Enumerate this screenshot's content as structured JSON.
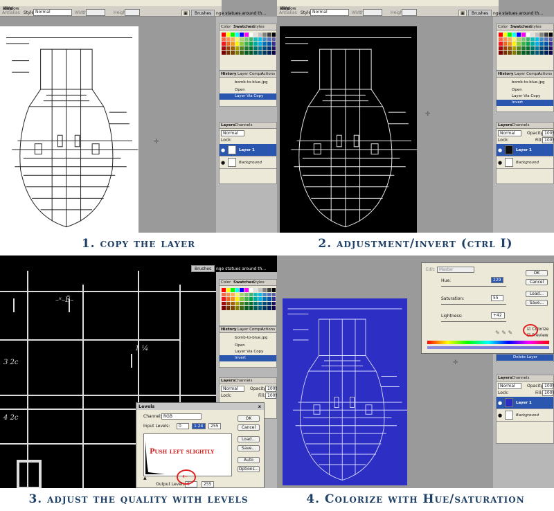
{
  "common": {
    "options": {
      "style_label": "Style:",
      "style_value": "Normal",
      "width_label": "Width:",
      "height_label": "Height:",
      "antialias": "Antialias"
    },
    "menu": [
      "View",
      "Window",
      "Help"
    ],
    "brushes_tab": "Brushes",
    "doc_title_fragment": "nge statues around th...",
    "color_panel_tabs": [
      "Color",
      "Swatches",
      "Styles"
    ],
    "history_tabs": [
      "History",
      "Layer Comps",
      "Actions"
    ],
    "history_file": "bomb-to-blue.jpg",
    "history_steps": [
      "Open",
      "Layer Via Copy",
      "Invert",
      "Delete Layer"
    ],
    "layers_tabs": [
      "Layers",
      "Channels"
    ],
    "blend_mode": "Normal",
    "opacity_label": "Opacity:",
    "opacity_value": "100%",
    "lock_label": "Lock:",
    "fill_label": "Fill:",
    "fill_value": "100%",
    "layer_names": [
      "Layer 1",
      "Background"
    ],
    "swatch_colors": [
      "#ff0000",
      "#ffff00",
      "#00ff00",
      "#00ffff",
      "#0000ff",
      "#ff00ff",
      "#ffffff",
      "#e0e0e0",
      "#c0c0c0",
      "#808080",
      "#404040",
      "#000000",
      "#f26c4f",
      "#f68e55",
      "#fbaf5c",
      "#fff467",
      "#acd372",
      "#7cc576",
      "#3bb878",
      "#1abbb4",
      "#00bff3",
      "#438ccb",
      "#5574b9",
      "#605ca8",
      "#ed1c24",
      "#f26522",
      "#f7941d",
      "#fff200",
      "#8dc63f",
      "#39b54a",
      "#00a651",
      "#00a99d",
      "#00aeef",
      "#0072bc",
      "#0054a6",
      "#2e3192",
      "#9e0b0f",
      "#a0410d",
      "#a36209",
      "#aba000",
      "#598527",
      "#197b30",
      "#007236",
      "#00746b",
      "#0076a3",
      "#004a80",
      "#003471",
      "#1b1464",
      "#790000",
      "#7b2e00",
      "#7d4900",
      "#827b00",
      "#406618",
      "#005e20",
      "#005826",
      "#005952",
      "#005b7f",
      "#003663",
      "#002157",
      "#0d004c"
    ]
  },
  "panels": [
    {
      "caption": "1. copy the layer"
    },
    {
      "caption": "2. adjustment/invert (ctrl I)"
    },
    {
      "caption": "3. adjust the quality with levels",
      "levels": {
        "title": "Levels",
        "close": "x",
        "channel_label": "Channel:",
        "channel_value": "RGB",
        "input_label": "Input Levels:",
        "input_values": [
          "0",
          "1.24",
          "255"
        ],
        "output_label": "Output Levels:",
        "output_values": [
          "0",
          "255"
        ],
        "buttons": [
          "OK",
          "Cancel",
          "Load...",
          "Save...",
          "Auto",
          "Options..."
        ],
        "annotation": "Push left slightly"
      }
    },
    {
      "caption": "4. Colorize with Hue/saturation",
      "hue_sat": {
        "edit_label": "Edit:",
        "edit_value": "Master",
        "hue_label": "Hue:",
        "hue_value": "229",
        "saturation_label": "Saturation:",
        "saturation_value": "55",
        "lightness_label": "Lightness:",
        "lightness_value": "+42",
        "buttons": [
          "OK",
          "Cancel",
          "Load...",
          "Save..."
        ],
        "colorize_label": "Colorize",
        "preview_label": "Preview",
        "colorize_checked": true,
        "preview_checked": true
      }
    }
  ]
}
